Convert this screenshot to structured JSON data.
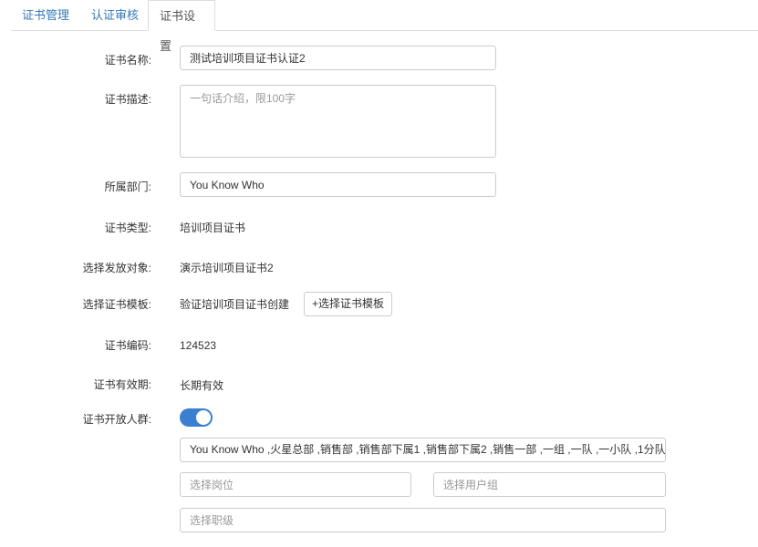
{
  "tabs": [
    {
      "label": "证书管理"
    },
    {
      "label": "认证审核"
    },
    {
      "label": "证书设置"
    }
  ],
  "form": {
    "name": {
      "label": "证书名称:",
      "value": "测试培训项目证书认证2"
    },
    "description": {
      "label": "证书描述:",
      "placeholder": "一句话介绍，限100字"
    },
    "department": {
      "label": "所属部门:",
      "value": "You Know Who"
    },
    "type": {
      "label": "证书类型:",
      "value": "培训项目证书"
    },
    "target": {
      "label": "选择发放对象:",
      "value": "演示培训项目证书2"
    },
    "template": {
      "label": "选择证书模板:",
      "value": "验证培训项目证书创建",
      "button": "+选择证书模板"
    },
    "code": {
      "label": "证书编码:",
      "value": "124523"
    },
    "validity": {
      "label": "证书有效期:",
      "value": "长期有效"
    },
    "audience": {
      "label": "证书开放人群:",
      "toggle_on": true,
      "departments": "You Know Who ,火星总部 ,销售部 ,销售部下属1 ,销售部下属2 ,销售一部 ,一组 ,一队 ,一小队 ,1分队",
      "position_placeholder": "选择岗位",
      "usergroup_placeholder": "选择用户组",
      "level_placeholder": "选择职级"
    }
  },
  "colors": {
    "accent": "#3b80d0",
    "tab_link": "#337ab7",
    "border": "#cccccc"
  }
}
